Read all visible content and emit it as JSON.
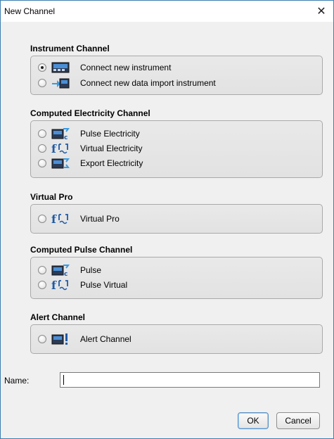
{
  "window": {
    "title": "New Channel",
    "close_glyph": "✕"
  },
  "groups": [
    {
      "label": "Instrument Channel",
      "items": [
        {
          "label": "Connect new instrument",
          "icon": "instrument-icon",
          "checked": true
        },
        {
          "label": "Connect new data import instrument",
          "icon": "data-import-instrument-icon",
          "checked": false
        }
      ]
    },
    {
      "label": "Computed Electricity Channel",
      "items": [
        {
          "label": "Pulse Electricity",
          "icon": "computed-channel-icon",
          "checked": false
        },
        {
          "label": "Virtual Electricity",
          "icon": "function-icon",
          "checked": false
        },
        {
          "label": "Export Electricity",
          "icon": "export-channel-icon",
          "checked": false
        }
      ]
    },
    {
      "label": "Virtual Pro",
      "items": [
        {
          "label": "Virtual Pro",
          "icon": "function-icon",
          "checked": false
        }
      ]
    },
    {
      "label": "Computed Pulse Channel",
      "items": [
        {
          "label": "Pulse",
          "icon": "computed-channel-icon",
          "checked": false
        },
        {
          "label": "Pulse Virtual",
          "icon": "function-icon",
          "checked": false
        }
      ]
    },
    {
      "label": "Alert Channel",
      "items": [
        {
          "label": "Alert Channel",
          "icon": "alert-channel-icon",
          "checked": false
        }
      ]
    }
  ],
  "name_field": {
    "label": "Name:",
    "value": "",
    "placeholder": ""
  },
  "buttons": {
    "ok": "OK",
    "cancel": "Cancel"
  },
  "colors": {
    "accent": "#3c7fb1",
    "icon_blue": "#1f5aa6",
    "icon_dark": "#2b3a55"
  }
}
